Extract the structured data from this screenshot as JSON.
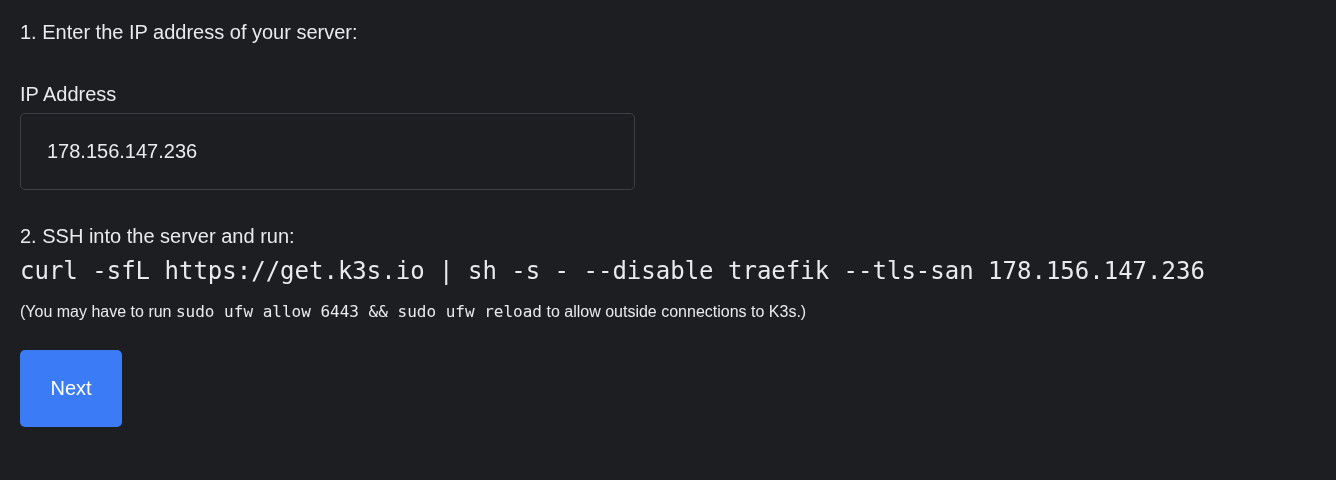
{
  "step_1": {
    "text": "1. Enter the IP address of your server:"
  },
  "ip_field": {
    "label": "IP Address",
    "value": "178.156.147.236"
  },
  "step_2": {
    "text": "2. SSH into the server and run:",
    "command": "curl -sfL https://get.k3s.io | sh -s - --disable traefik --tls-san 178.156.147.236"
  },
  "note": {
    "parts": [
      {
        "kind": "text",
        "text": "(You may have to run "
      },
      {
        "kind": "code",
        "text": "sudo ufw allow 6443 && sudo ufw reload"
      },
      {
        "kind": "text",
        "text": " to allow outside connections to K3s.)"
      }
    ]
  },
  "next_button": {
    "label": "Next"
  }
}
